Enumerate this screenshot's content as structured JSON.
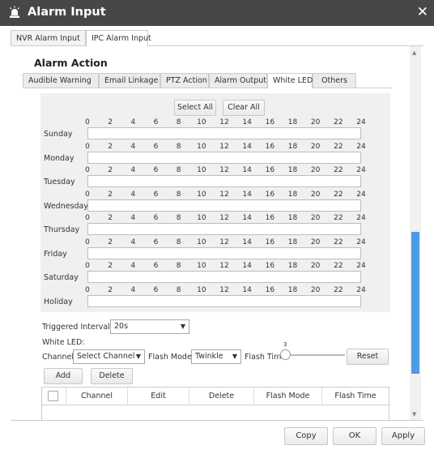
{
  "window": {
    "title": "Alarm Input",
    "title_icon": "alarm-light-icon",
    "close_glyph": "✕"
  },
  "outer_tabs": [
    "NVR Alarm Input",
    "IPC Alarm Input"
  ],
  "section_title": "Alarm Action",
  "inner_tabs": [
    "Audible Warning",
    "Email Linkage",
    "PTZ Action",
    "Alarm Output",
    "White LED",
    "Others"
  ],
  "schedule": {
    "select_all": "Select All",
    "clear_all": "Clear All",
    "hours": [
      "0",
      "2",
      "4",
      "6",
      "8",
      "10",
      "12",
      "14",
      "16",
      "18",
      "20",
      "22",
      "24"
    ],
    "days": [
      "Sunday",
      "Monday",
      "Tuesday",
      "Wednesday",
      "Thursday",
      "Friday",
      "Saturday",
      "Holiday"
    ]
  },
  "triggered_interval": {
    "label": "Triggered Interval:",
    "value": "20s"
  },
  "white_led": {
    "label": "White LED:",
    "channel_label": "Channel",
    "channel_value": "Select Channel",
    "flash_mode_label": "Flash Mode",
    "flash_mode_value": "Twinkle",
    "flash_time_label": "Flash Time",
    "flash_time_value": "3",
    "reset": "Reset",
    "add": "Add",
    "delete": "Delete"
  },
  "table": {
    "columns": [
      "Channel",
      "Edit",
      "Delete",
      "Flash Mode",
      "Flash Time"
    ]
  },
  "footer": {
    "copy": "Copy",
    "ok": "OK",
    "apply": "Apply"
  },
  "colors": {
    "titlebar": "#474747",
    "scroll_thumb": "#4c9ce5",
    "schedule_bg": "#f0f0f0"
  }
}
